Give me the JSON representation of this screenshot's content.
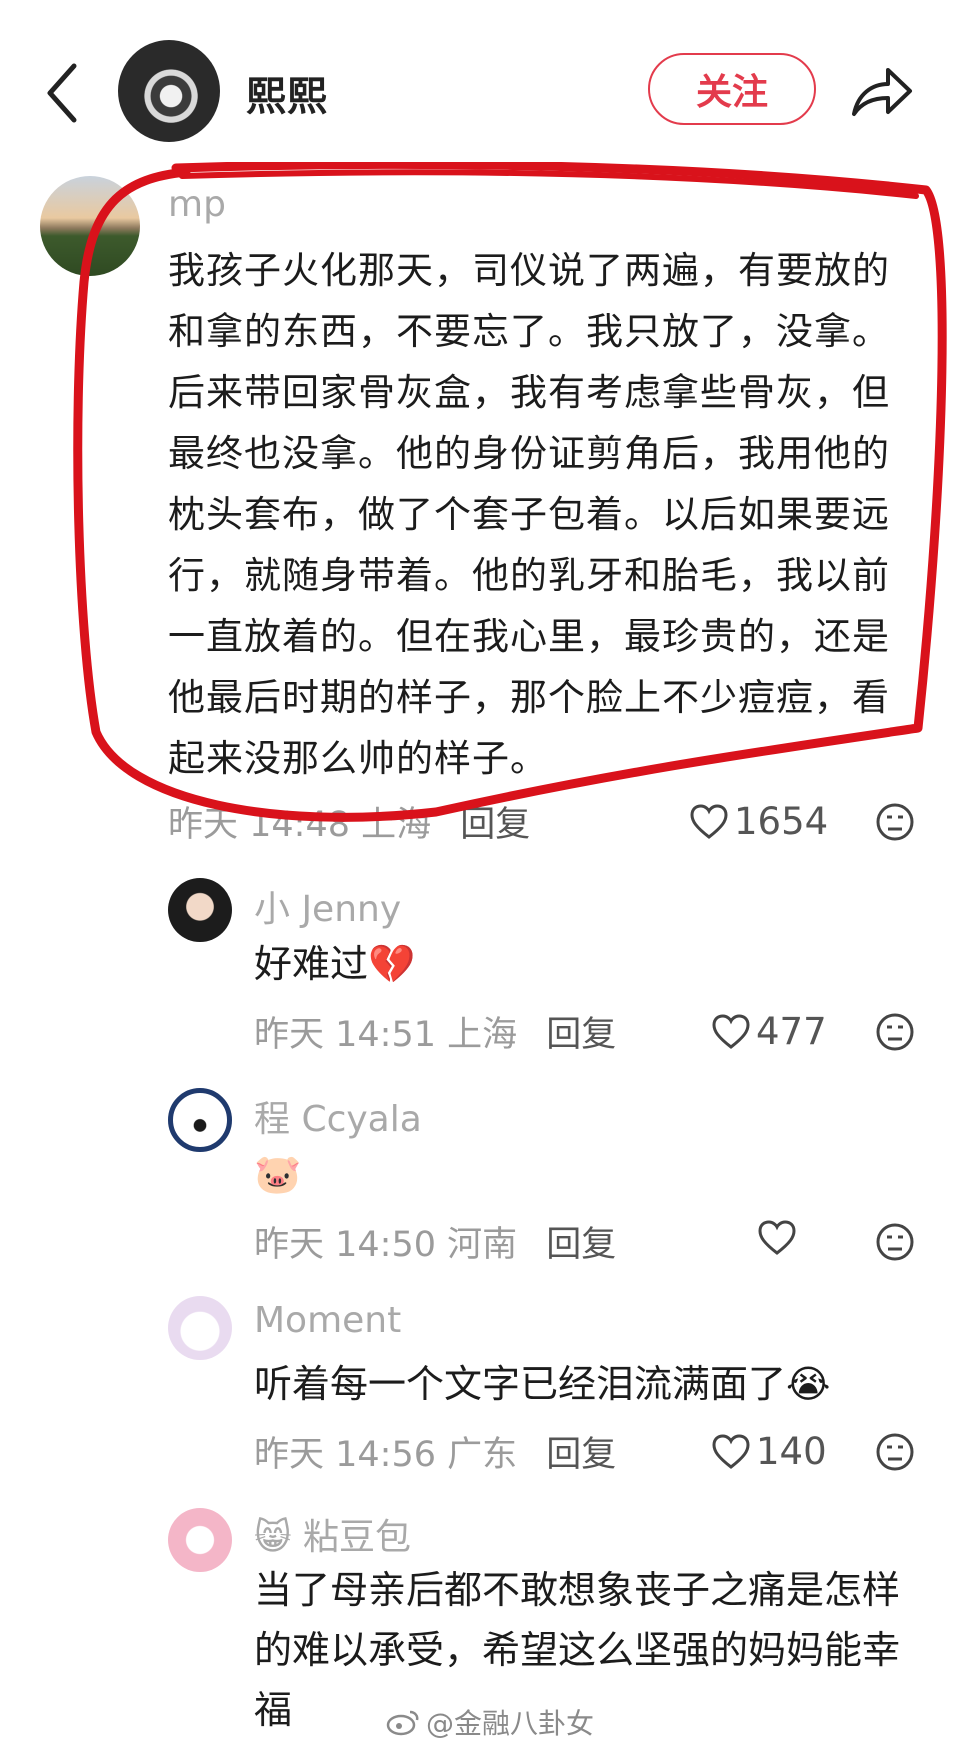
{
  "header": {
    "author_name": "熙熙",
    "follow_label": "关注"
  },
  "comments": [
    {
      "user": "mp",
      "text": "我孩子火化那天，司仪说了两遍，有要放的和拿的东西，不要忘了。我只放了，没拿。后来带回家骨灰盒，我有考虑拿些骨灰，但最终也没拿。他的身份证剪角后，我用他的枕头套布，做了个套子包着。以后如果要远行，就随身带着。他的乳牙和胎毛，我以前一直放着的。但在我心里，最珍贵的，还是他最后时期的样子，那个脸上不少痘痘，看起来没那么帅的样子。",
      "time": "昨天 14:48",
      "location": "上海",
      "reply": "回复",
      "likes": "1654"
    },
    {
      "user": "小 Jenny",
      "text": "好难过💔",
      "time": "昨天 14:51",
      "location": "上海",
      "reply": "回复",
      "likes": "477"
    },
    {
      "user": "程 Ccyala",
      "text": "🐷",
      "time": "昨天 14:50",
      "location": "河南",
      "reply": "回复",
      "likes": ""
    },
    {
      "user": "Moment",
      "text": "听着每一个文字已经泪流满面了😭",
      "time": "昨天 14:56",
      "location": "广东",
      "reply": "回复",
      "likes": "140"
    },
    {
      "user": "😸 粘豆包",
      "text": "当了母亲后都不敢想象丧子之痛是怎样的难以承受，希望这么坚强的妈妈能幸福"
    }
  ],
  "watermark": "@金融八卦女",
  "colors": {
    "accent": "#e33b4c",
    "annotation": "#d9121b",
    "meta": "#9b9b9b"
  }
}
